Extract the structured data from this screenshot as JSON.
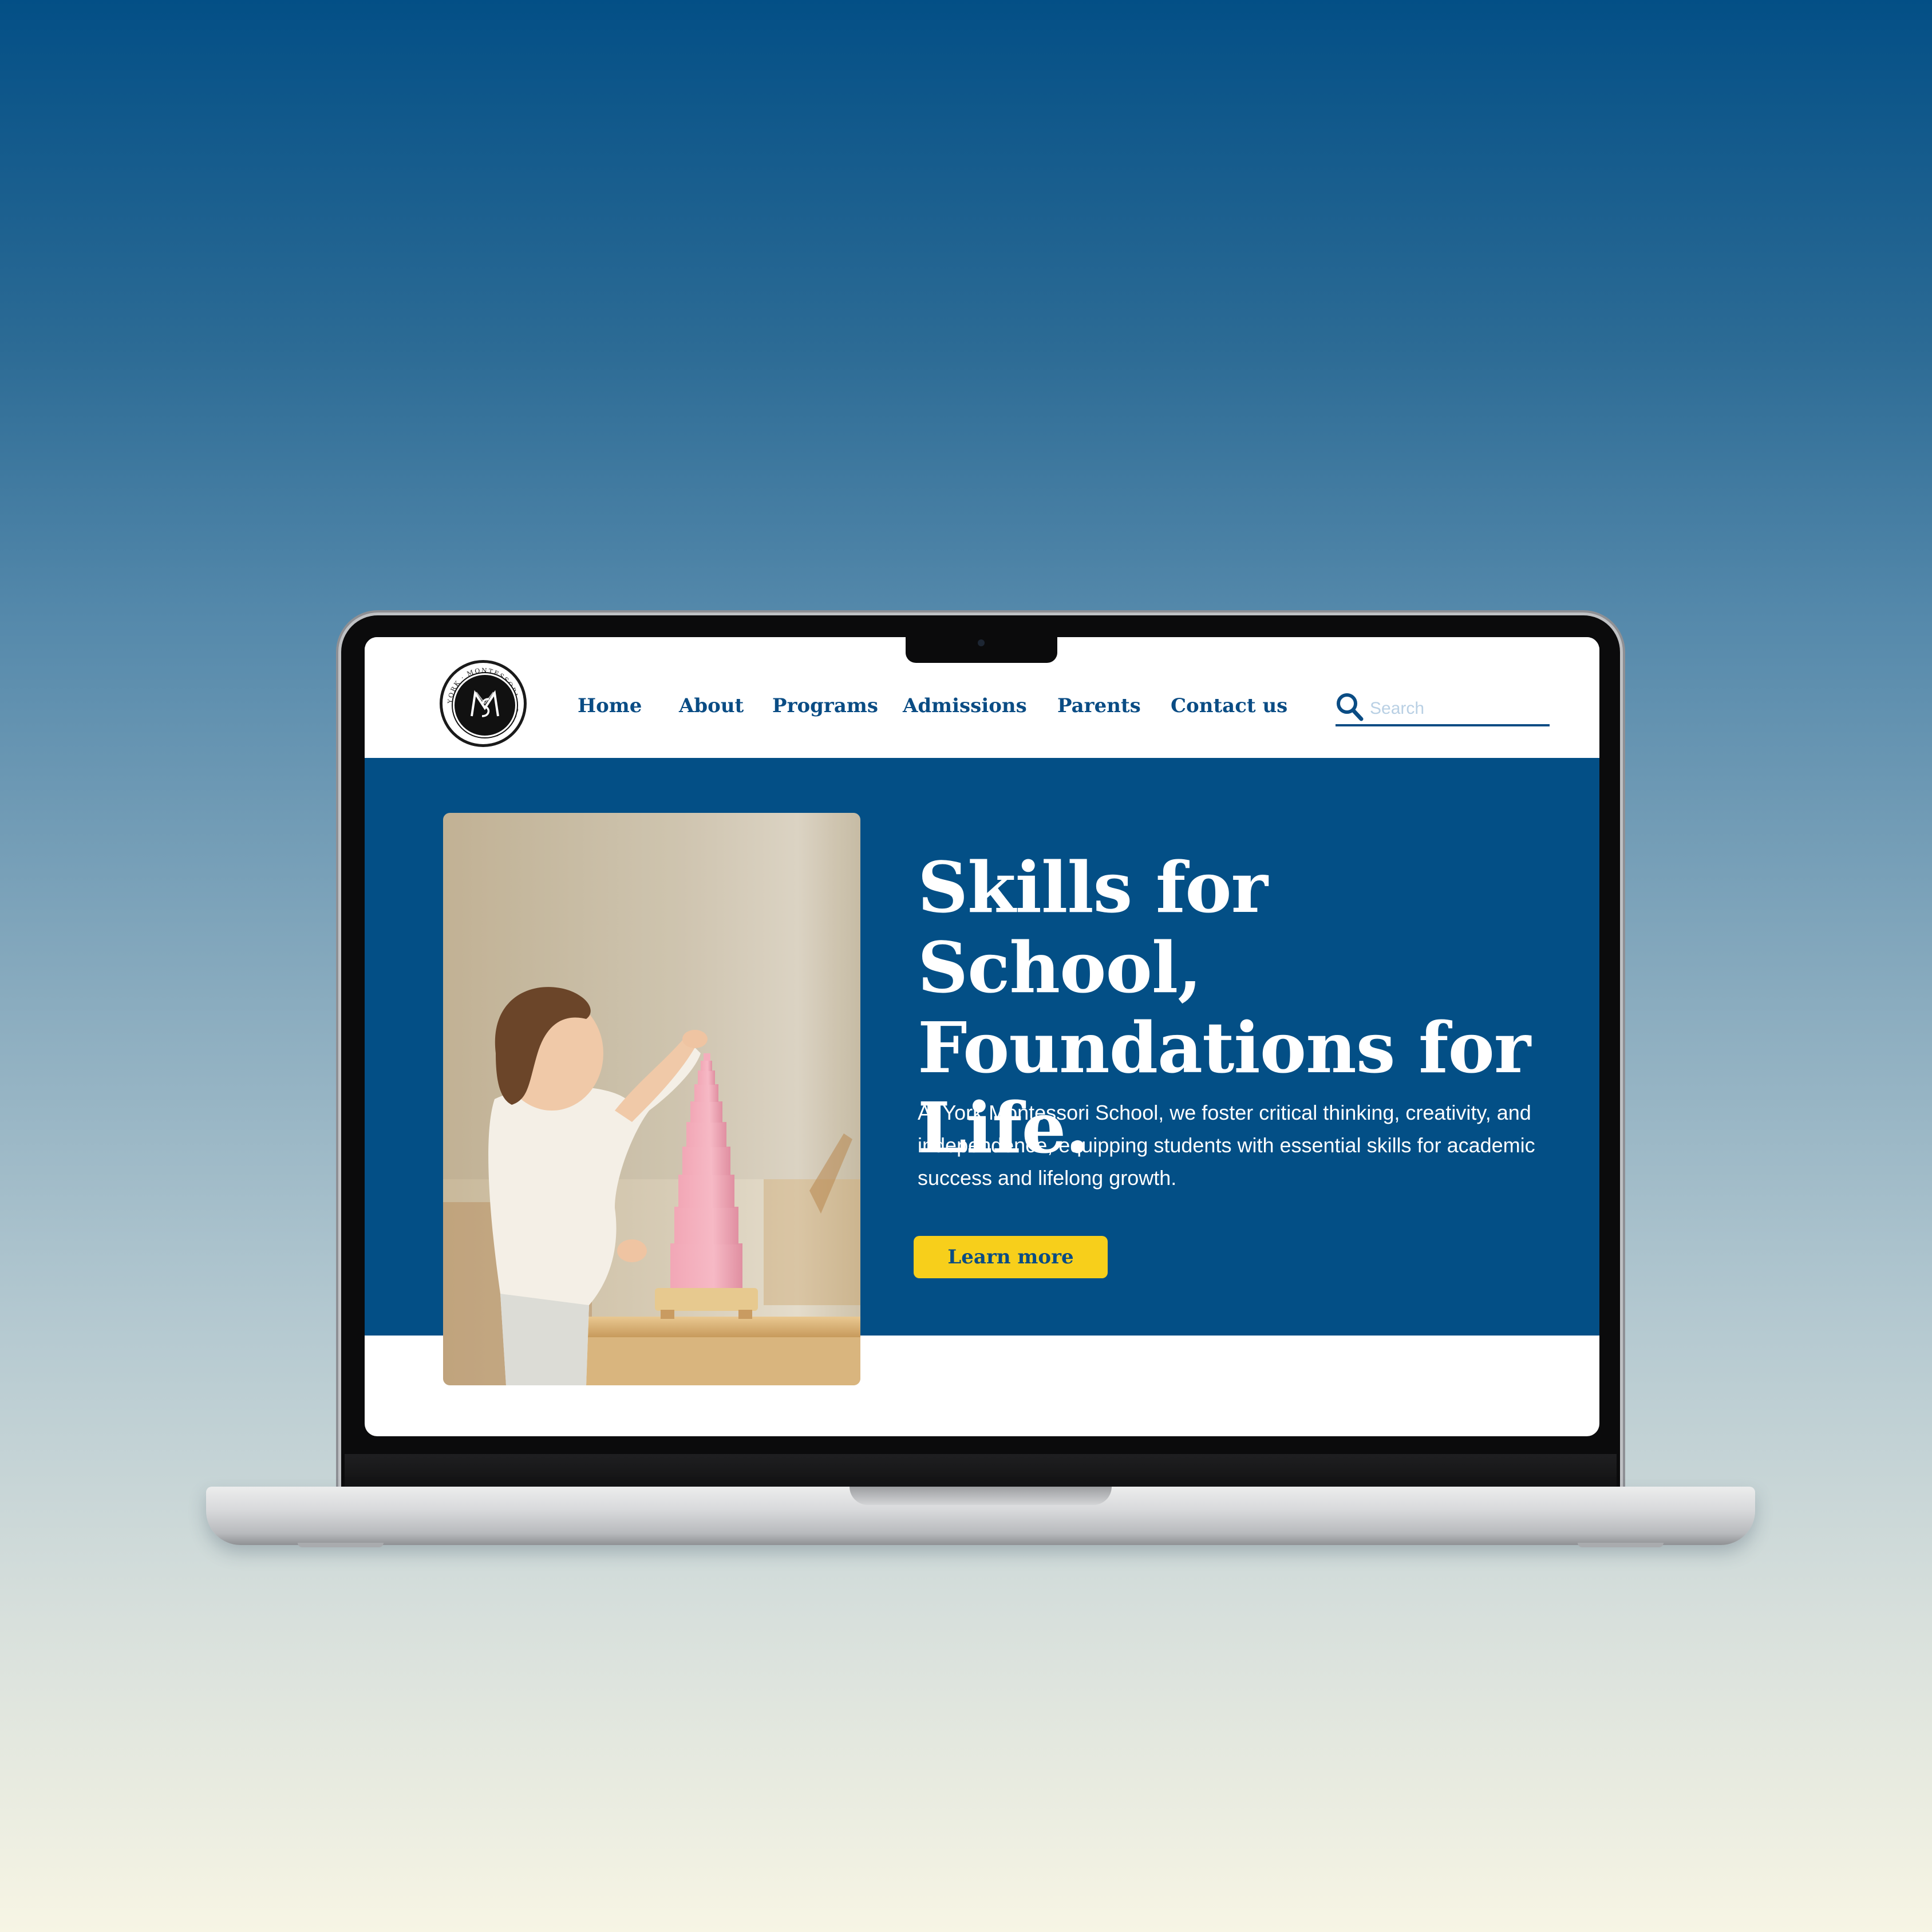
{
  "brand": {
    "logo_alt": "York Montessori School logo",
    "logo_ring_text": "YORK · MONTESSORI · SCHOOL",
    "logo_monogram": "YMS"
  },
  "nav": {
    "items": [
      {
        "label": "Home"
      },
      {
        "label": "About"
      },
      {
        "label": "Programs"
      },
      {
        "label": "Admissions"
      },
      {
        "label": "Parents"
      },
      {
        "label": "Contact us"
      }
    ]
  },
  "search": {
    "placeholder": "Search",
    "value": "",
    "icon": "search-icon"
  },
  "hero": {
    "title": "Skills for School, Foundations for Life.",
    "body": "At York Montessori School, we foster critical thinking, creativity, and independence, equipping students with essential skills for academic success and lifelong growth.",
    "cta_label": "Learn more",
    "image_alt": "Child stacking a pink tower of Montessori blocks on a wooden table"
  },
  "colors": {
    "primary": "#034f86",
    "nav_text": "#0a4c84",
    "accent": "#f7cf1b",
    "background_top": "#034f86",
    "background_bottom": "#f7f5e4"
  }
}
